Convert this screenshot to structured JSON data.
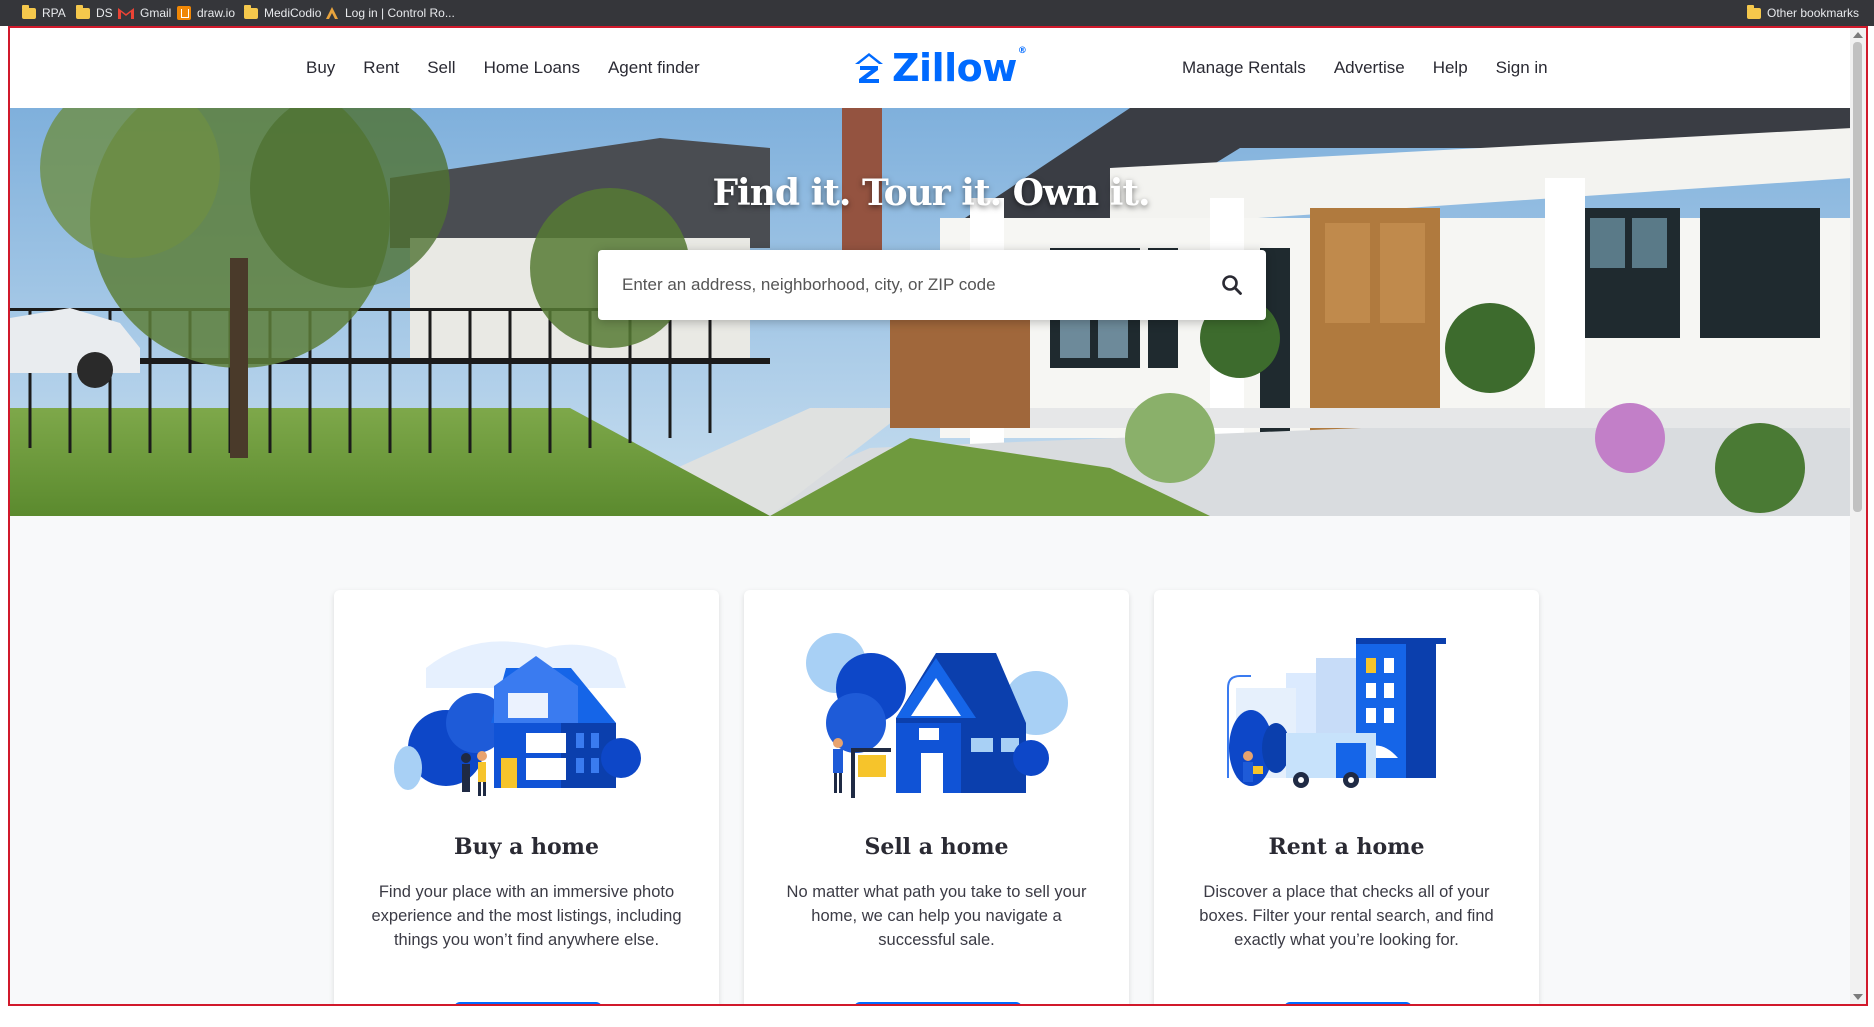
{
  "bookmarks": {
    "items": [
      {
        "label": "RPA",
        "icon": "folder-icon"
      },
      {
        "label": "DS",
        "icon": "folder-icon"
      },
      {
        "label": "Gmail",
        "icon": "gmail-icon"
      },
      {
        "label": "draw.io",
        "icon": "drawio-icon"
      },
      {
        "label": "MediCodio",
        "icon": "folder-icon"
      },
      {
        "label": "Log in | Control Ro...",
        "icon": "control-icon"
      }
    ],
    "other": "Other bookmarks"
  },
  "header": {
    "left_nav": [
      "Buy",
      "Rent",
      "Sell",
      "Home Loans",
      "Agent finder"
    ],
    "logo": "Zillow",
    "right_nav": [
      "Manage Rentals",
      "Advertise",
      "Help",
      "Sign in"
    ]
  },
  "hero": {
    "title": "Find it. Tour it. Own it.",
    "search_placeholder": "Enter an address, neighborhood, city, or ZIP code"
  },
  "cards": [
    {
      "title": "Buy a home",
      "description": "Find your place with an immersive photo experience and the most listings, including things you won’t find anywhere else."
    },
    {
      "title": "Sell a home",
      "description": "No matter what path you take to sell your home, we can help you navigate a successful sale."
    },
    {
      "title": "Rent a home",
      "description": "Discover a place that checks all of your boxes. Filter your rental search, and find exactly what you’re looking for."
    }
  ],
  "colors": {
    "brand_blue": "#006aff",
    "frame_border": "#d1192b",
    "bookmarks_bg": "#35363a"
  }
}
